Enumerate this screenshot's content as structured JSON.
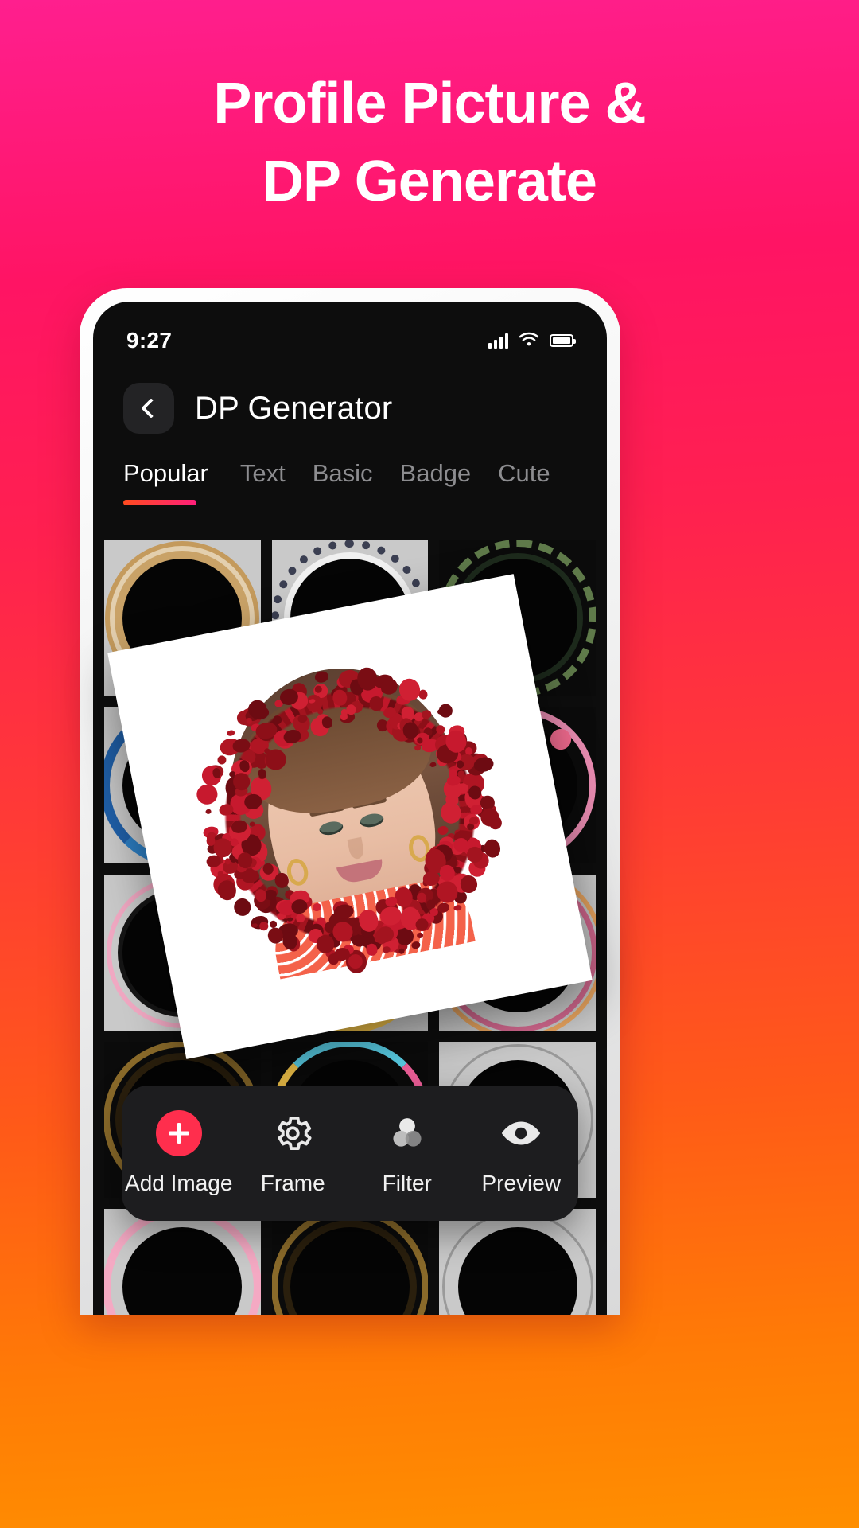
{
  "promo": {
    "line1": "Profile Picture &",
    "line2": "DP Generate"
  },
  "status_bar": {
    "time": "9:27",
    "signal_icon": "signal-bars-icon",
    "wifi_icon": "wifi-icon",
    "battery_icon": "battery-icon"
  },
  "app_bar": {
    "back_icon": "chevron-left-icon",
    "title": "DP Generator"
  },
  "tabs": {
    "active_index": 0,
    "items": [
      {
        "label": "Popular"
      },
      {
        "label": "Text"
      },
      {
        "label": "Basic"
      },
      {
        "label": "Badge"
      },
      {
        "label": "Cute"
      }
    ]
  },
  "frame_grid": {
    "items": [
      {
        "name": "basket-floral-frame"
      },
      {
        "name": "lace-dotted-frame"
      },
      {
        "name": "green-leaf-frame"
      },
      {
        "name": "blue-watercolor-frame"
      },
      {
        "name": "pink-blossom-frame"
      },
      {
        "name": "red-floral-frame"
      },
      {
        "name": "pink-butterfly-frame"
      },
      {
        "name": "yellow-floral-frame"
      },
      {
        "name": "rainbow-ring-frame"
      },
      {
        "name": "gold-vine-frame"
      },
      {
        "name": "neon-gradient-ring-frame"
      },
      {
        "name": "thin-outline-frame"
      },
      {
        "name": "pink-floral-frame-2"
      },
      {
        "name": "dark-ornament-frame"
      },
      {
        "name": "plain-ring-frame"
      }
    ]
  },
  "preview_card": {
    "name": "red-berry-wreath-portrait-preview",
    "frame": "red-berry-wreath",
    "subject": "young-woman-portrait"
  },
  "toolbar": {
    "items": [
      {
        "label": "Add Image",
        "icon": "plus-circle-icon"
      },
      {
        "label": "Frame",
        "icon": "gear-icon"
      },
      {
        "label": "Filter",
        "icon": "overlapping-circles-icon"
      },
      {
        "label": "Preview",
        "icon": "eye-icon"
      }
    ]
  },
  "colors": {
    "accent_pink": "#ff1f7a",
    "accent_orange": "#ff4b1f",
    "add_button": "#ff2e4d",
    "screen_bg": "#0d0d0d",
    "toolbar_bg": "#1d1d1f"
  }
}
